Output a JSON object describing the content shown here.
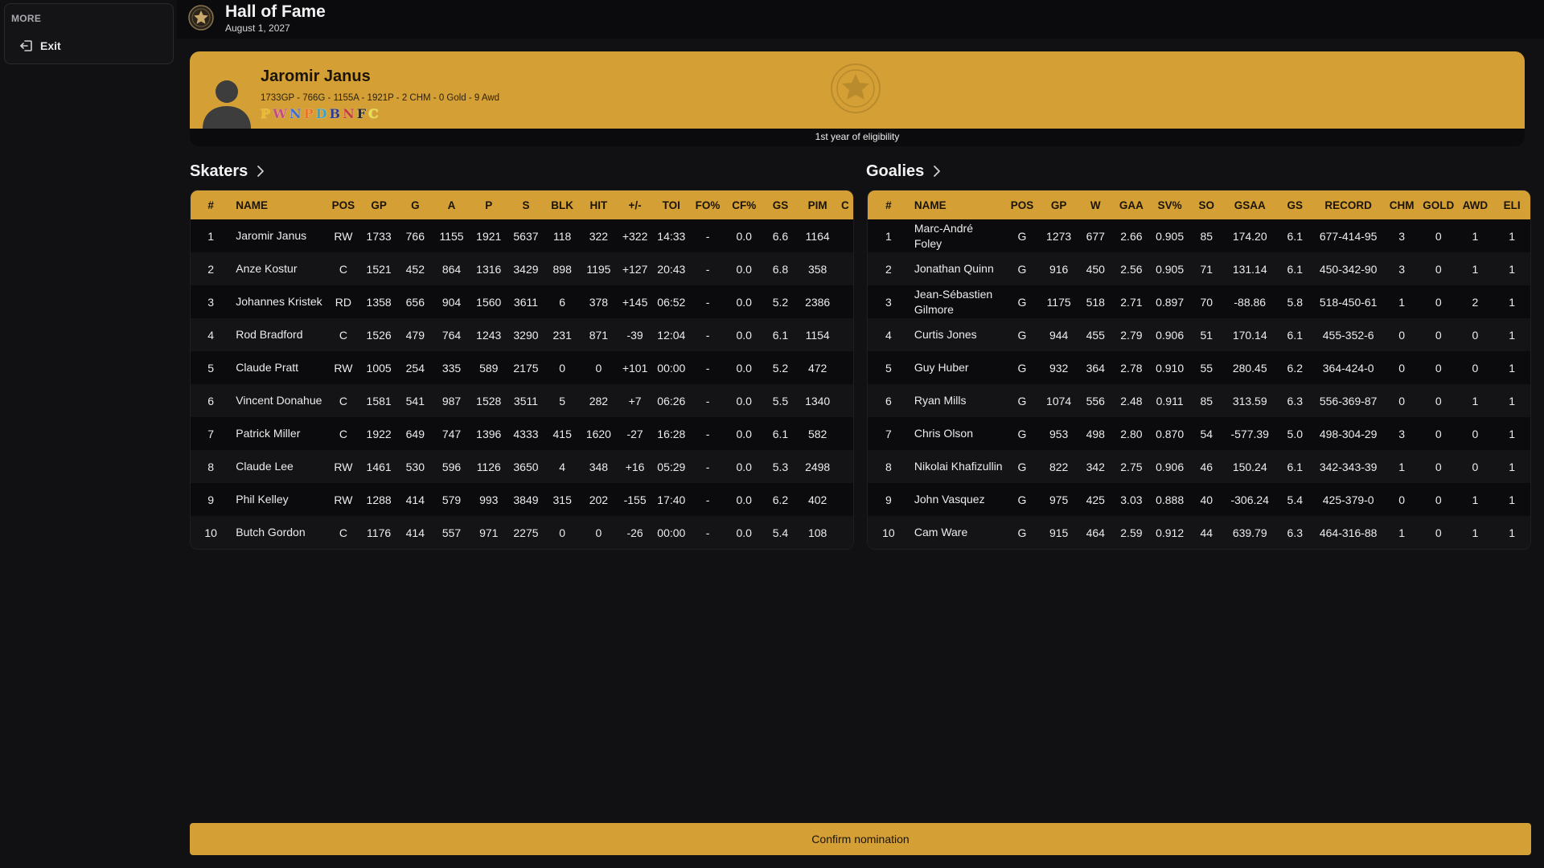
{
  "sidebar": {
    "section_label": "MORE",
    "exit_label": "Exit"
  },
  "header": {
    "title": "Hall of Fame",
    "date": "August 1, 2027"
  },
  "nominee": {
    "name": "Jaromir Janus",
    "stats_line": "1733GP - 766G - 1155A - 1921P - 2 CHM - 0 Gold - 9 Awd",
    "badges": [
      {
        "letter": "P",
        "color": "#e8b92a"
      },
      {
        "letter": "W",
        "color": "#c44b86"
      },
      {
        "letter": "N",
        "color": "#3e6cd8"
      },
      {
        "letter": "P",
        "color": "#e8742a"
      },
      {
        "letter": "D",
        "color": "#3aa0c8"
      },
      {
        "letter": "B",
        "color": "#2d3a8c"
      },
      {
        "letter": "N",
        "color": "#c43a3a"
      },
      {
        "letter": "F",
        "color": "#2a2a2a"
      },
      {
        "letter": "C",
        "color": "#e8e04a"
      }
    ],
    "eligibility": "1st year of eligibility"
  },
  "skaters": {
    "title": "Skaters",
    "columns": [
      "#",
      "NAME",
      "POS",
      "GP",
      "G",
      "A",
      "P",
      "S",
      "BLK",
      "HIT",
      "+/-",
      "TOI",
      "FO%",
      "CF%",
      "GS",
      "PIM",
      "C"
    ],
    "rows": [
      [
        "1",
        "Jaromir Janus",
        "RW",
        "1733",
        "766",
        "1155",
        "1921",
        "5637",
        "118",
        "322",
        "+322",
        "14:33",
        "-",
        "0.0",
        "6.6",
        "1164",
        ""
      ],
      [
        "2",
        "Anze Kostur",
        "C",
        "1521",
        "452",
        "864",
        "1316",
        "3429",
        "898",
        "1195",
        "+127",
        "20:43",
        "-",
        "0.0",
        "6.8",
        "358",
        ""
      ],
      [
        "3",
        "Johannes Kristek",
        "RD",
        "1358",
        "656",
        "904",
        "1560",
        "3611",
        "6",
        "378",
        "+145",
        "06:52",
        "-",
        "0.0",
        "5.2",
        "2386",
        ""
      ],
      [
        "4",
        "Rod Bradford",
        "C",
        "1526",
        "479",
        "764",
        "1243",
        "3290",
        "231",
        "871",
        "-39",
        "12:04",
        "-",
        "0.0",
        "6.1",
        "1154",
        ""
      ],
      [
        "5",
        "Claude Pratt",
        "RW",
        "1005",
        "254",
        "335",
        "589",
        "2175",
        "0",
        "0",
        "+101",
        "00:00",
        "-",
        "0.0",
        "5.2",
        "472",
        ""
      ],
      [
        "6",
        "Vincent Donahue",
        "C",
        "1581",
        "541",
        "987",
        "1528",
        "3511",
        "5",
        "282",
        "+7",
        "06:26",
        "-",
        "0.0",
        "5.5",
        "1340",
        ""
      ],
      [
        "7",
        "Patrick Miller",
        "C",
        "1922",
        "649",
        "747",
        "1396",
        "4333",
        "415",
        "1620",
        "-27",
        "16:28",
        "-",
        "0.0",
        "6.1",
        "582",
        ""
      ],
      [
        "8",
        "Claude Lee",
        "RW",
        "1461",
        "530",
        "596",
        "1126",
        "3650",
        "4",
        "348",
        "+16",
        "05:29",
        "-",
        "0.0",
        "5.3",
        "2498",
        ""
      ],
      [
        "9",
        "Phil Kelley",
        "RW",
        "1288",
        "414",
        "579",
        "993",
        "3849",
        "315",
        "202",
        "-155",
        "17:40",
        "-",
        "0.0",
        "6.2",
        "402",
        ""
      ],
      [
        "10",
        "Butch Gordon",
        "C",
        "1176",
        "414",
        "557",
        "971",
        "2275",
        "0",
        "0",
        "-26",
        "00:00",
        "-",
        "0.0",
        "5.4",
        "108",
        ""
      ]
    ]
  },
  "goalies": {
    "title": "Goalies",
    "columns": [
      "#",
      "NAME",
      "POS",
      "GP",
      "W",
      "GAA",
      "SV%",
      "SO",
      "GSAA",
      "GS",
      "RECORD",
      "CHM",
      "GOLD",
      "AWD",
      "ELI"
    ],
    "rows": [
      [
        "1",
        "Marc-André Foley",
        "G",
        "1273",
        "677",
        "2.66",
        "0.905",
        "85",
        "174.20",
        "6.1",
        "677-414-95",
        "3",
        "0",
        "1",
        "1"
      ],
      [
        "2",
        "Jonathan Quinn",
        "G",
        "916",
        "450",
        "2.56",
        "0.905",
        "71",
        "131.14",
        "6.1",
        "450-342-90",
        "3",
        "0",
        "1",
        "1"
      ],
      [
        "3",
        "Jean-Sébastien Gilmore",
        "G",
        "1175",
        "518",
        "2.71",
        "0.897",
        "70",
        "-88.86",
        "5.8",
        "518-450-61",
        "1",
        "0",
        "2",
        "1"
      ],
      [
        "4",
        "Curtis Jones",
        "G",
        "944",
        "455",
        "2.79",
        "0.906",
        "51",
        "170.14",
        "6.1",
        "455-352-6",
        "0",
        "0",
        "0",
        "1"
      ],
      [
        "5",
        "Guy Huber",
        "G",
        "932",
        "364",
        "2.78",
        "0.910",
        "55",
        "280.45",
        "6.2",
        "364-424-0",
        "0",
        "0",
        "0",
        "1"
      ],
      [
        "6",
        "Ryan Mills",
        "G",
        "1074",
        "556",
        "2.48",
        "0.911",
        "85",
        "313.59",
        "6.3",
        "556-369-87",
        "0",
        "0",
        "1",
        "1"
      ],
      [
        "7",
        "Chris Olson",
        "G",
        "953",
        "498",
        "2.80",
        "0.870",
        "54",
        "-577.39",
        "5.0",
        "498-304-29",
        "3",
        "0",
        "0",
        "1"
      ],
      [
        "8",
        "Nikolai Khafizullin",
        "G",
        "822",
        "342",
        "2.75",
        "0.906",
        "46",
        "150.24",
        "6.1",
        "342-343-39",
        "1",
        "0",
        "0",
        "1"
      ],
      [
        "9",
        "John Vasquez",
        "G",
        "975",
        "425",
        "3.03",
        "0.888",
        "40",
        "-306.24",
        "5.4",
        "425-379-0",
        "0",
        "0",
        "1",
        "1"
      ],
      [
        "10",
        "Cam Ware",
        "G",
        "915",
        "464",
        "2.59",
        "0.912",
        "44",
        "639.79",
        "6.3",
        "464-316-88",
        "1",
        "0",
        "1",
        "1"
      ]
    ]
  },
  "footer": {
    "confirm_label": "Confirm nomination"
  },
  "colors": {
    "accent": "#d4a035",
    "background": "#111113",
    "row_alt": "#141417"
  }
}
